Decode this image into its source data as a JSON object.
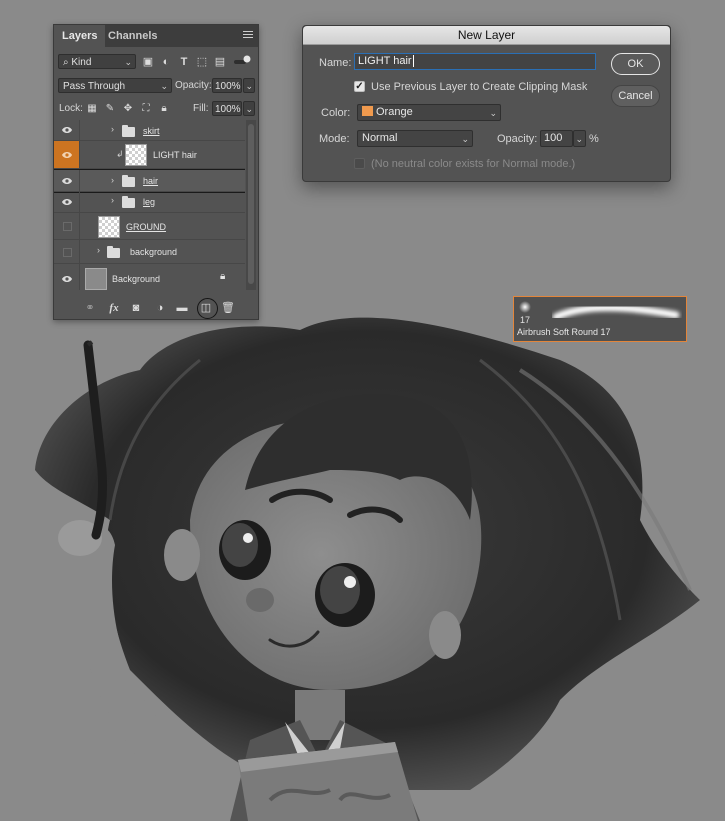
{
  "layers_panel": {
    "tabs": [
      {
        "label": "Layers"
      },
      {
        "label": "Channels"
      }
    ],
    "filter": {
      "kind": "Kind"
    },
    "blend_mode": "Pass Through",
    "opacity_label": "Opacity:",
    "opacity_value": "100%",
    "lock_label": "Lock:",
    "fill_label": "Fill:",
    "fill_value": "100%",
    "layers": [
      {
        "name": "skirt",
        "type": "group",
        "visible": true
      },
      {
        "name": "LIGHT hair",
        "type": "clipping-layer",
        "visible": true,
        "color_label": "orange"
      },
      {
        "name": "hair",
        "type": "group",
        "visible": true,
        "selected": true
      },
      {
        "name": "leg",
        "type": "group",
        "visible": true
      },
      {
        "name": "GROUND",
        "type": "layer",
        "visible": false
      },
      {
        "name": "background",
        "type": "group",
        "visible": false
      },
      {
        "name": "Background",
        "type": "background",
        "visible": true,
        "locked": true
      }
    ]
  },
  "dialog": {
    "title": "New Layer",
    "name_label": "Name:",
    "name_value": "LIGHT hair",
    "clip_label": "Use Previous Layer to Create Clipping Mask",
    "clip_checked": true,
    "color_label": "Color:",
    "color_value": "Orange",
    "color_hex": "#f09a4e",
    "mode_label": "Mode:",
    "mode_value": "Normal",
    "opacity_label": "Opacity:",
    "opacity_value": "100",
    "opacity_unit": "%",
    "neutral_label": "(No neutral color exists for Normal mode.)",
    "neutral_checked": false,
    "ok_label": "OK",
    "cancel_label": "Cancel"
  },
  "brush": {
    "size": "17",
    "name": "Airbrush Soft Round 17",
    "accent": "#e3853a"
  },
  "colors": {
    "panel_bg": "#535353",
    "workspace_bg": "#8a8a8a",
    "label_orange": "#cc7421"
  }
}
